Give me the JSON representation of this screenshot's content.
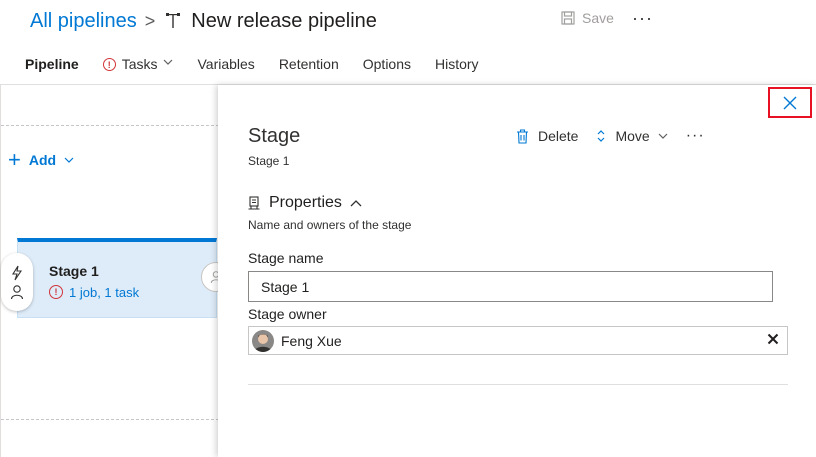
{
  "header": {
    "breadcrumb_root": "All pipelines",
    "breadcrumb_sep": ">",
    "title": "New release pipeline",
    "save_label": "Save",
    "more_label": "···"
  },
  "tabs": [
    {
      "label": "Pipeline",
      "active": true
    },
    {
      "label": "Tasks",
      "has_error": true,
      "has_dropdown": true
    },
    {
      "label": "Variables"
    },
    {
      "label": "Retention"
    },
    {
      "label": "Options"
    },
    {
      "label": "History"
    }
  ],
  "canvas": {
    "add_label": "Add",
    "add_icon": "+",
    "stage_card": {
      "name": "Stage 1",
      "error_icon": "!",
      "summary": "1 job, 1 task"
    }
  },
  "panel": {
    "title": "Stage",
    "subtitle": "Stage 1",
    "delete_label": "Delete",
    "move_label": "Move",
    "more_label": "···",
    "properties": {
      "heading": "Properties",
      "description": "Name and owners of the stage"
    },
    "stage_name_label": "Stage name",
    "stage_name_value": "Stage 1",
    "stage_owner_label": "Stage owner",
    "stage_owner_value": "Feng Xue"
  },
  "colors": {
    "accent": "#0078d4",
    "error": "#d13438",
    "close_highlight": "#e81123",
    "stage_card_bg": "#deecf9"
  },
  "icons": [
    "chevron-right-icon",
    "pipeline-icon",
    "save-icon",
    "more-icon",
    "error-icon",
    "chevron-down-icon",
    "plus-icon",
    "lightning-icon",
    "person-icon",
    "close-icon",
    "delete-icon",
    "move-icon",
    "properties-icon",
    "chevron-up-icon",
    "clear-icon"
  ]
}
